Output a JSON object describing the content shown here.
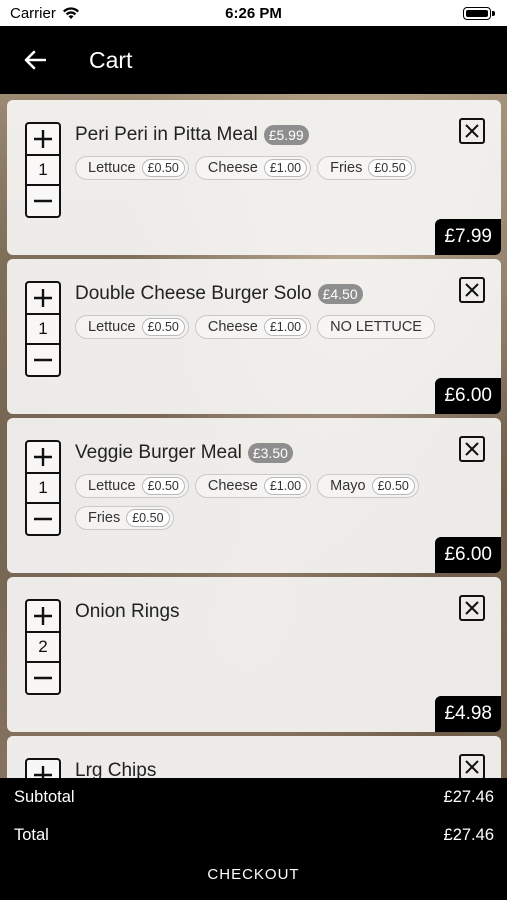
{
  "status_bar": {
    "carrier": "Carrier",
    "time": "6:26 PM"
  },
  "nav": {
    "title": "Cart"
  },
  "icons": {
    "back": "arrow-left-icon",
    "remove": "close-icon",
    "increment": "plus-icon",
    "decrement": "minus-icon"
  },
  "cart_items": [
    {
      "name": "Peri Peri in Pitta Meal",
      "base_price": "£5.99",
      "quantity": "1",
      "options": [
        {
          "label": "Lettuce",
          "price": "£0.50"
        },
        {
          "label": "Cheese",
          "price": "£1.00"
        },
        {
          "label": "Fries",
          "price": "£0.50"
        }
      ],
      "total": "£7.99"
    },
    {
      "name": "Double Cheese Burger Solo",
      "base_price": "£4.50",
      "quantity": "1",
      "options": [
        {
          "label": "Lettuce",
          "price": "£0.50"
        },
        {
          "label": "Cheese",
          "price": "£1.00"
        },
        {
          "label": "NO LETTUCE",
          "price": ""
        }
      ],
      "total": "£6.00"
    },
    {
      "name": "Veggie Burger Meal",
      "base_price": "£3.50",
      "quantity": "1",
      "options": [
        {
          "label": "Lettuce",
          "price": "£0.50"
        },
        {
          "label": "Cheese",
          "price": "£1.00"
        },
        {
          "label": "Mayo",
          "price": "£0.50"
        },
        {
          "label": "Fries",
          "price": "£0.50"
        }
      ],
      "total": "£6.00"
    },
    {
      "name": "Onion Rings",
      "base_price": "",
      "quantity": "2",
      "options": [],
      "total": "£4.98"
    },
    {
      "name": "Lrg Chips",
      "base_price": "",
      "quantity": "",
      "options": [],
      "total": ""
    }
  ],
  "summary": {
    "subtotal_label": "Subtotal",
    "subtotal_value": "£27.46",
    "total_label": "Total",
    "total_value": "£27.46",
    "checkout_label": "CHECKOUT"
  }
}
